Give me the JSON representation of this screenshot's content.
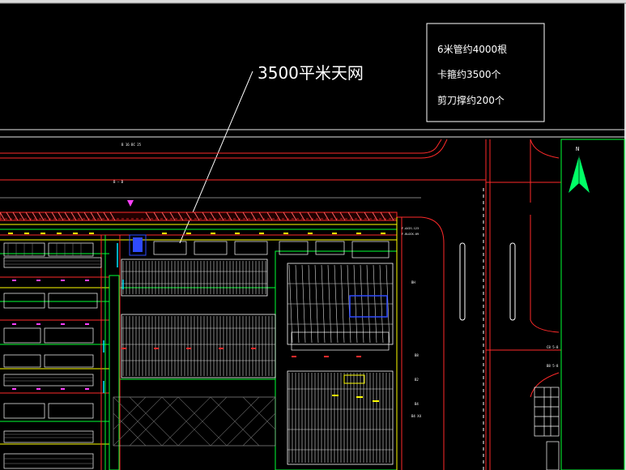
{
  "callout": {
    "label": "3500平米天网"
  },
  "notes": {
    "lines": [
      "6米管约4000根",
      "卡箍约3500个",
      "剪刀撑约200个"
    ]
  },
  "north_arrow": {
    "label": "N"
  },
  "small_labels": {
    "road_label_top": "B 16 BC 25",
    "axis_label": "B — B",
    "building_tag_1": "F-AXIS-123",
    "building_tag_2": "F-BLOCK-09",
    "right_tag_1": "C8  5-8",
    "right_tag_2": "B8  5-8",
    "plot_label_1": "BH",
    "plot_label_2": "B4 X4",
    "plot_label_3": "B8",
    "plot_label_4": "B2",
    "plot_label_5": "B4"
  },
  "colors": {
    "background": "#000000",
    "white": "#ffffff",
    "red": "#ff2a2a",
    "green": "#00ff33",
    "yellow": "#ffff00",
    "cyan": "#00e5ff",
    "magenta": "#ff40ff",
    "blue": "#2f4bff",
    "north_green": "#00ff66"
  }
}
